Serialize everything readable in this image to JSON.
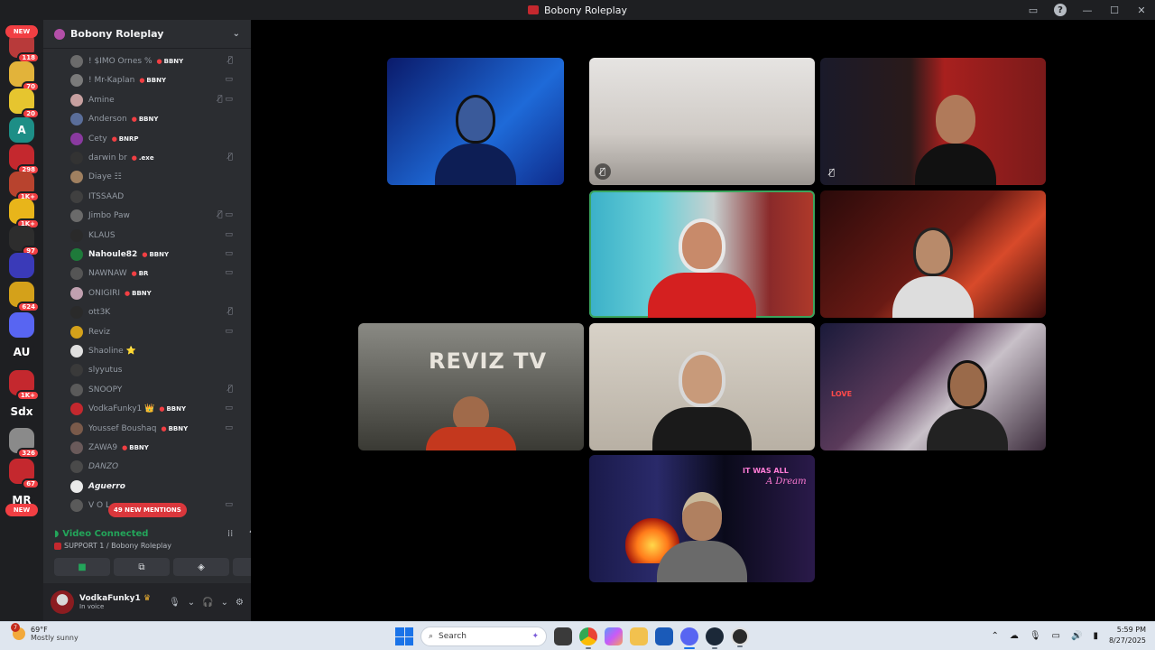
{
  "window": {
    "title": "Bobony Roleplay"
  },
  "guilds": [
    {
      "label": "",
      "badge": "118",
      "color": "#b83a3a"
    },
    {
      "label": "",
      "badge": "70",
      "color": "#e2b33a"
    },
    {
      "label": "",
      "badge": "20",
      "color": "#e6c52f"
    },
    {
      "label": "A",
      "badge": "",
      "color": "#1d8e86"
    },
    {
      "label": "",
      "badge": "298",
      "color": "#c4282e"
    },
    {
      "label": "",
      "badge": "1K+",
      "color": "#b8432e"
    },
    {
      "label": "",
      "badge": "1K+",
      "color": "#e8b51a"
    },
    {
      "label": "",
      "badge": "97",
      "color": "#2d2d2d"
    },
    {
      "label": "",
      "badge": "",
      "color": "#3a3ab8"
    },
    {
      "label": "",
      "badge": "624",
      "color": "#d4a11a"
    },
    {
      "label": "",
      "badge": "",
      "color": "#5865f2"
    },
    {
      "label": "AU",
      "badge": "",
      "color": "#1e1f22"
    },
    {
      "label": "",
      "badge": "1K+",
      "color": "#c4282e"
    },
    {
      "label": "Sdx",
      "badge": "",
      "color": "#1e1f22"
    },
    {
      "label": "",
      "badge": "326",
      "color": "#8a8a8a"
    },
    {
      "label": "",
      "badge": "67",
      "color": "#c4282e"
    },
    {
      "label": "MR",
      "badge": "",
      "color": "#1e1f22"
    }
  ],
  "guild_new_label": "NEW",
  "server": {
    "name": "Bobony Roleplay"
  },
  "members": [
    {
      "name": "! $IMO Ornes %",
      "tag": "BBNY",
      "icons": "🎙̸",
      "color": "#6b6b6b",
      "style": ""
    },
    {
      "name": "! Mr-Kaplan",
      "tag": "BBNY",
      "icons": "▭",
      "color": "#7a7a7a",
      "style": ""
    },
    {
      "name": "Amine",
      "tag": "",
      "icons": "🎙̸ ▭",
      "color": "#c7a0a0",
      "style": ""
    },
    {
      "name": "Anderson",
      "tag": "BBNY",
      "icons": "",
      "color": "#5a6e9a",
      "style": ""
    },
    {
      "name": "Cety",
      "tag": "BNRP",
      "icons": "",
      "color": "#8a3aa0",
      "style": ""
    },
    {
      "name": "darwin br",
      "tag": ".exe",
      "icons": "🎙̸",
      "color": "#333333",
      "style": ""
    },
    {
      "name": "Diaye ☷",
      "tag": "",
      "icons": "",
      "color": "#a08060",
      "style": ""
    },
    {
      "name": "ITSSAAD",
      "tag": "",
      "icons": "",
      "color": "#404040",
      "style": ""
    },
    {
      "name": "Jimbo Paw",
      "tag": "",
      "icons": "🎙̸ ▭",
      "color": "#6a6a6a",
      "style": ""
    },
    {
      "name": "KLAUS",
      "tag": "",
      "icons": "▭",
      "color": "#2a2a2a",
      "style": ""
    },
    {
      "name": "Nahoule82",
      "tag": "BBNY",
      "icons": "▭",
      "color": "#1e7a3a",
      "style": "bold"
    },
    {
      "name": "NAWNAW",
      "tag": "BR",
      "icons": "▭",
      "color": "#555555",
      "style": ""
    },
    {
      "name": "ONIGIRI",
      "tag": "BBNY",
      "icons": "",
      "color": "#c0a0b0",
      "style": ""
    },
    {
      "name": "ott3K",
      "tag": "",
      "icons": "🎙̸",
      "color": "#2a2a2a",
      "style": ""
    },
    {
      "name": "Reviz",
      "tag": "",
      "icons": "▭",
      "color": "#d4a11a",
      "style": ""
    },
    {
      "name": "Shaoline ⭐",
      "tag": "",
      "icons": "",
      "color": "#e0e0e0",
      "style": ""
    },
    {
      "name": "slyyutus",
      "tag": "",
      "icons": "",
      "color": "#3a3a3a",
      "style": ""
    },
    {
      "name": "SNOOPY",
      "tag": "",
      "icons": "🎙̸",
      "color": "#5a5a5a",
      "style": ""
    },
    {
      "name": "VodkaFunky1 👑",
      "tag": "BBNY",
      "icons": "▭",
      "color": "#c4282e",
      "style": ""
    },
    {
      "name": "Youssef Boushaq",
      "tag": "BBNY",
      "icons": "▭",
      "color": "#7a5a4a",
      "style": ""
    },
    {
      "name": "ZAWA9",
      "tag": "BBNY",
      "icons": "",
      "color": "#6a5a5a",
      "style": ""
    },
    {
      "name": "DANZO",
      "tag": "",
      "icons": "",
      "color": "#4a4a4a",
      "style": "italic"
    },
    {
      "name": "Aguerro",
      "tag": "",
      "icons": "",
      "color": "#eaeaea",
      "style": "italic bold"
    },
    {
      "name": "V O L",
      "tag": "",
      "icons": "▭",
      "color": "#5a5a5a",
      "style": ""
    }
  ],
  "mentions_label": "49 NEW MENTIONS",
  "voice": {
    "status": "Video Connected",
    "channel": "SUPPORT 1 / Bobony Roleplay"
  },
  "user": {
    "name": "VodkaFunky1",
    "status": "In voice"
  },
  "tiles": {
    "reviz_text": "REVIZ TV",
    "dream_line1": "IT WAS ALL",
    "dream_line2": "A Dream",
    "love_text": "LOVE"
  },
  "taskbar": {
    "weather_temp": "69°F",
    "weather_desc": "Mostly sunny",
    "weather_badge": "7",
    "search_placeholder": "Search",
    "time": "5:59 PM",
    "date": "8/27/2025"
  },
  "colors": {
    "accent_green": "#23a55a",
    "danger_red": "#f23f43",
    "sidebar_bg": "#2b2d31",
    "guild_bg": "#1e1f22"
  }
}
